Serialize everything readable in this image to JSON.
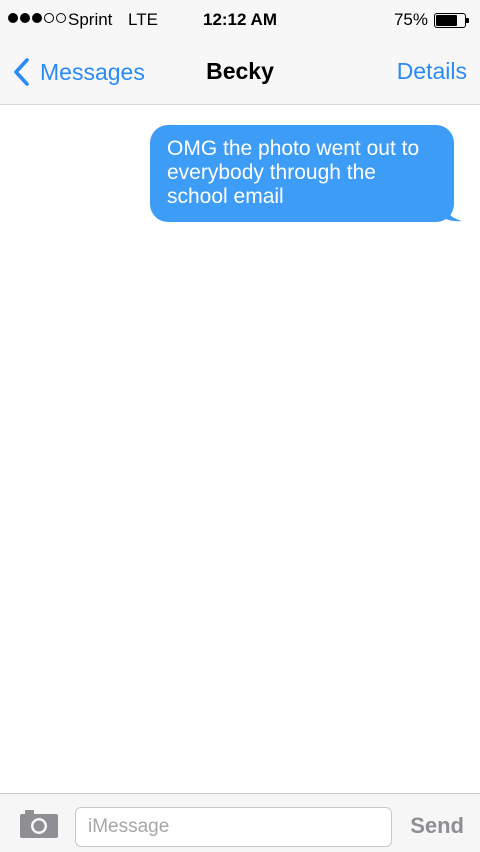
{
  "status_bar": {
    "signal_full_dots": 3,
    "signal_empty_dots": 2,
    "carrier": "Sprint",
    "network": "LTE",
    "time": "12:12 AM",
    "battery_percent_label": "75%",
    "battery_level": 0.75
  },
  "nav": {
    "back_label": "Messages",
    "title": "Becky",
    "details_label": "Details"
  },
  "messages": [
    {
      "direction": "outgoing",
      "text": "OMG the photo went out to everybody through the school email"
    }
  ],
  "input_bar": {
    "camera_icon": "camera-icon",
    "placeholder": "iMessage",
    "send_label": "Send"
  },
  "colors": {
    "accent": "#2a8af6",
    "bubble": "#3d9cf5",
    "send_disabled": "#8e8e93"
  }
}
